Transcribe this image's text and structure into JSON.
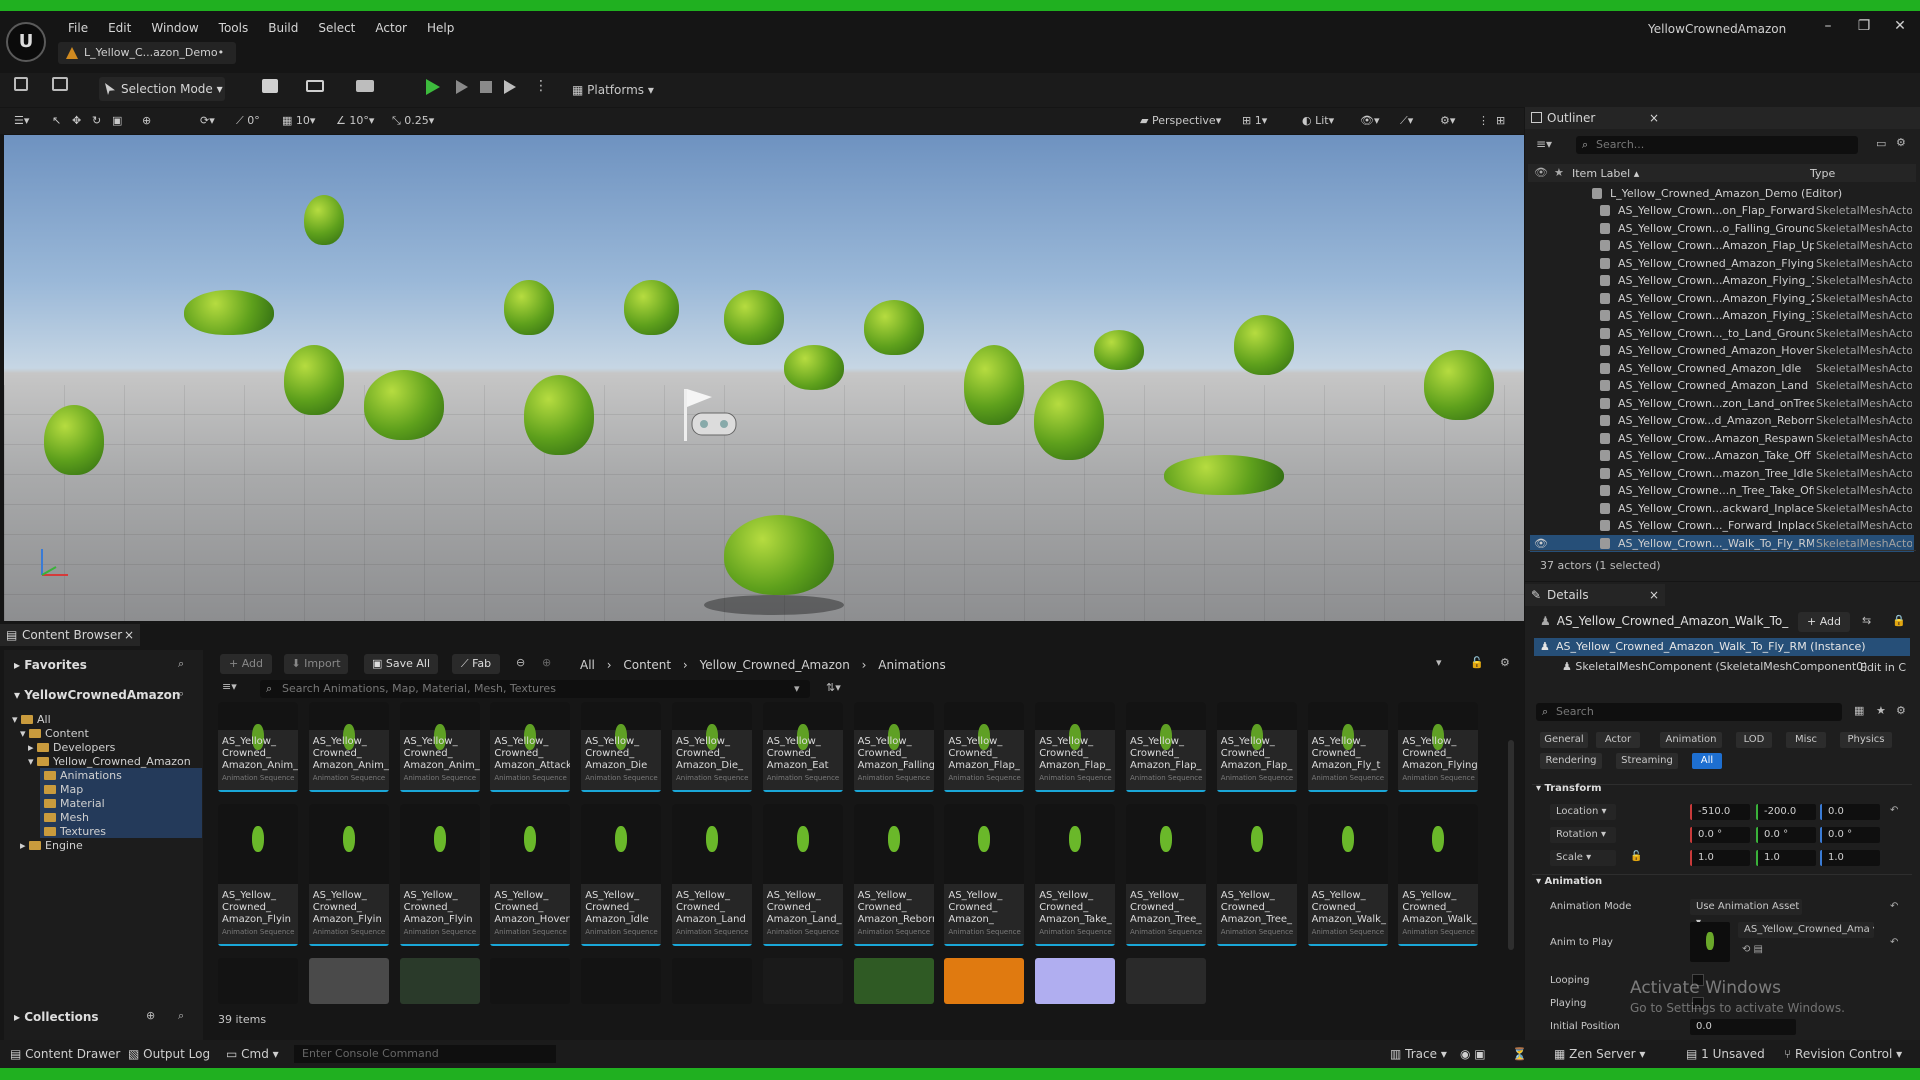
{
  "window": {
    "menu": [
      "File",
      "Edit",
      "Window",
      "Tools",
      "Build",
      "Select",
      "Actor",
      "Help"
    ],
    "doc_tab": "L_Yellow_C...azon_Demo•",
    "project": "YellowCrownedAmazon",
    "controls": [
      "–",
      "❐",
      "✕"
    ]
  },
  "toolbar": {
    "selection_mode": "Selection Mode",
    "platforms": "Platforms"
  },
  "viewport_toolbar": {
    "rot_snap": "0°",
    "grid_snap": "10",
    "angle_snap": "10°",
    "scale_snap": "0.25",
    "perspective": "Perspective",
    "cam_count": "1",
    "lit": "Lit"
  },
  "outliner": {
    "tab": "Outliner",
    "search_placeholder": "Search...",
    "col_label": "Item Label ▴",
    "col_type": "Type",
    "root": "L_Yellow_Crowned_Amazon_Demo (Editor)",
    "rows": [
      {
        "name": "AS_Yellow_Crown...on_Flap_Forward",
        "type": "SkeletalMeshActo"
      },
      {
        "name": "AS_Yellow_Crown...o_Falling_Ground",
        "type": "SkeletalMeshActo"
      },
      {
        "name": "AS_Yellow_Crown...Amazon_Flap_Up",
        "type": "SkeletalMeshActo"
      },
      {
        "name": "AS_Yellow_Crowned_Amazon_Flying",
        "type": "SkeletalMeshActo"
      },
      {
        "name": "AS_Yellow_Crown...Amazon_Flying_1",
        "type": "SkeletalMeshActo"
      },
      {
        "name": "AS_Yellow_Crown...Amazon_Flying_2",
        "type": "SkeletalMeshActo"
      },
      {
        "name": "AS_Yellow_Crown...Amazon_Flying_3",
        "type": "SkeletalMeshActo"
      },
      {
        "name": "AS_Yellow_Crown..._to_Land_Ground",
        "type": "SkeletalMeshActo"
      },
      {
        "name": "AS_Yellow_Crowned_Amazon_Hover",
        "type": "SkeletalMeshActo"
      },
      {
        "name": "AS_Yellow_Crowned_Amazon_Idle",
        "type": "SkeletalMeshActo"
      },
      {
        "name": "AS_Yellow_Crowned_Amazon_Land",
        "type": "SkeletalMeshActo"
      },
      {
        "name": "AS_Yellow_Crown...zon_Land_onTree",
        "type": "SkeletalMeshActo"
      },
      {
        "name": "AS_Yellow_Crow...d_Amazon_Reborn",
        "type": "SkeletalMeshActo"
      },
      {
        "name": "AS_Yellow_Crow...Amazon_Respawn",
        "type": "SkeletalMeshActo"
      },
      {
        "name": "AS_Yellow_Crow...Amazon_Take_Off",
        "type": "SkeletalMeshActo"
      },
      {
        "name": "AS_Yellow_Crown...mazon_Tree_Idle",
        "type": "SkeletalMeshActo"
      },
      {
        "name": "AS_Yellow_Crowne...n_Tree_Take_Off",
        "type": "SkeletalMeshActo"
      },
      {
        "name": "AS_Yellow_Crown...ackward_Inplace",
        "type": "SkeletalMeshActo"
      },
      {
        "name": "AS_Yellow_Crown..._Forward_Inplace",
        "type": "SkeletalMeshActo"
      },
      {
        "name": "AS_Yellow_Crown..._Walk_To_Fly_RM",
        "type": "SkeletalMeshActo"
      }
    ],
    "footer": "37 actors (1 selected)"
  },
  "details": {
    "tab": "Details",
    "actor_name": "AS_Yellow_Crowned_Amazon_Walk_To_",
    "add": "+ Add",
    "instance": "AS_Yellow_Crowned_Amazon_Walk_To_Fly_RM (Instance)",
    "component": "SkeletalMeshComponent (SkeletalMeshComponent0)",
    "edit_in": "Edit in C",
    "search_placeholder": "Search",
    "cats_row1": [
      "General",
      "Actor",
      "Animation",
      "LOD",
      "Misc",
      "Physics"
    ],
    "cats_row2": [
      "Rendering",
      "Streaming",
      "All"
    ],
    "transform_header": "Transform",
    "location_label": "Location",
    "rotation_label": "Rotation",
    "scale_label": "Scale",
    "location": [
      "-510.0",
      "-200.0",
      "0.0"
    ],
    "rotation": [
      "0.0 °",
      "0.0 °",
      "0.0 °"
    ],
    "scale": [
      "1.0",
      "1.0",
      "1.0"
    ],
    "animation_header": "Animation",
    "anim_mode_label": "Animation Mode",
    "anim_mode_value": "Use Animation Asset",
    "anim_to_play_label": "Anim to Play",
    "anim_to_play_value": "AS_Yellow_Crowned_Ama",
    "looping_label": "Looping",
    "playing_label": "Playing",
    "initial_position_label": "Initial Position",
    "initial_position_value": "0.0"
  },
  "content_browser": {
    "tab": "Content Browser",
    "favorites": "Favorites",
    "project": "YellowCrownedAmazon",
    "tree": [
      "All",
      "Content",
      "Developers",
      "Yellow_Crowned_Amazon",
      "Animations",
      "Map",
      "Material",
      "Mesh",
      "Textures",
      "Engine"
    ],
    "collections": "Collections",
    "add": "+ Add",
    "import": "Import",
    "save_all": "Save All",
    "fab": "Fab",
    "breadcrumb": [
      "All",
      "Content",
      "Yellow_Crowned_Amazon",
      "Animations"
    ],
    "search_placeholder": "Search Animations, Map, Material, Mesh, Textures",
    "item_count": "39 items",
    "type_label": "Animation Sequence",
    "row1": [
      "AS_Yellow_\nCrowned_\nAmazon_Anim_",
      "AS_Yellow_\nCrowned_\nAmazon_Anim_",
      "AS_Yellow_\nCrowned_\nAmazon_Anim_",
      "AS_Yellow_\nCrowned_\nAmazon_Attack",
      "AS_Yellow_\nCrowned_\nAmazon_Die",
      "AS_Yellow_\nCrowned_\nAmazon_Die_",
      "AS_Yellow_\nCrowned_\nAmazon_Eat",
      "AS_Yellow_\nCrowned_\nAmazon_Falling",
      "AS_Yellow_\nCrowned_\nAmazon_Flap_",
      "AS_Yellow_\nCrowned_\nAmazon_Flap_",
      "AS_Yellow_\nCrowned_\nAmazon_Flap_",
      "AS_Yellow_\nCrowned_\nAmazon_Flap_",
      "AS_Yellow_\nCrowned_\nAmazon_Fly_t",
      "AS_Yellow_\nCrowned_\nAmazon_Flying"
    ],
    "row2": [
      "AS_Yellow_\nCrowned_\nAmazon_Flyin",
      "AS_Yellow_\nCrowned_\nAmazon_Flyin",
      "AS_Yellow_\nCrowned_\nAmazon_Flyin",
      "AS_Yellow_\nCrowned_\nAmazon_Hover",
      "AS_Yellow_\nCrowned_\nAmazon_Idle",
      "AS_Yellow_\nCrowned_\nAmazon_Land",
      "AS_Yellow_\nCrowned_\nAmazon_Land_",
      "AS_Yellow_\nCrowned_\nAmazon_Reborn",
      "AS_Yellow_\nCrowned_\nAmazon_",
      "AS_Yellow_\nCrowned_\nAmazon_Take_",
      "AS_Yellow_\nCrowned_\nAmazon_Tree_",
      "AS_Yellow_\nCrowned_\nAmazon_Tree_",
      "AS_Yellow_\nCrowned_\nAmazon_Walk_",
      "AS_Yellow_\nCrowned_\nAmazon_Walk_"
    ]
  },
  "statusbar": {
    "content_drawer": "Content Drawer",
    "output_log": "Output Log",
    "cmd": "Cmd",
    "console_placeholder": "Enter Console Command",
    "trace": "Trace",
    "zen_server": "Zen Server",
    "unsaved": "1 Unsaved",
    "revision": "Revision Control"
  },
  "watermark": {
    "title": "Activate Windows",
    "subtitle": "Go to Settings to activate Windows."
  }
}
